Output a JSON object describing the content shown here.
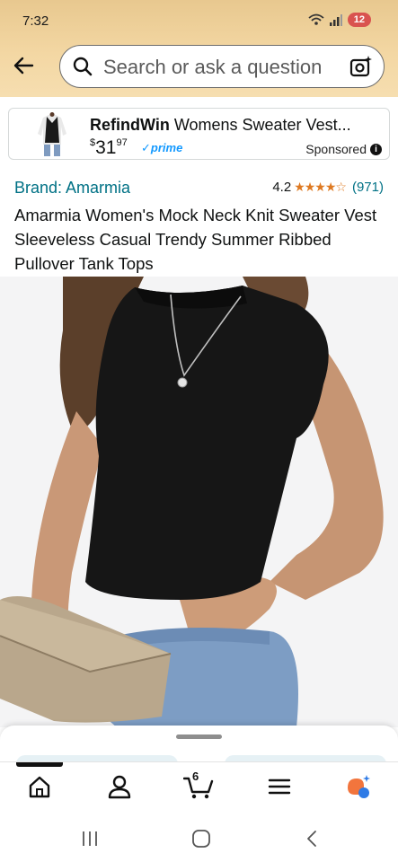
{
  "status_bar": {
    "time": "7:32",
    "battery": "12"
  },
  "search": {
    "placeholder": "Search or ask a question"
  },
  "sponsored_ad": {
    "brand": "RefindWin",
    "title": " Womens Sweater Vest...",
    "price_symbol": "$",
    "price_whole": "31",
    "price_fraction": "97",
    "prime": "prime",
    "sponsored_label": "Sponsored",
    "info_glyph": "i"
  },
  "product": {
    "brand_link": "Brand: Amarmia",
    "rating_value": "4.2",
    "stars": "★★★★☆",
    "review_count": "(971)",
    "title": "Amarmia Women's Mock Neck Knit Sweater Vest Sleeveless Casual Trendy Summer Ribbed Pullover Tank Tops"
  },
  "bottom_nav": {
    "items": [
      "home-icon",
      "account-icon",
      "cart-icon",
      "menu-icon",
      "rufus-icon"
    ],
    "cart_count": "6"
  },
  "colors": {
    "header_gradient_top": "#e8c88f",
    "link": "#007185",
    "star": "#de7921",
    "prime": "#1399ff",
    "rufus_orange": "#f2753d",
    "rufus_blue": "#2f7be6"
  }
}
